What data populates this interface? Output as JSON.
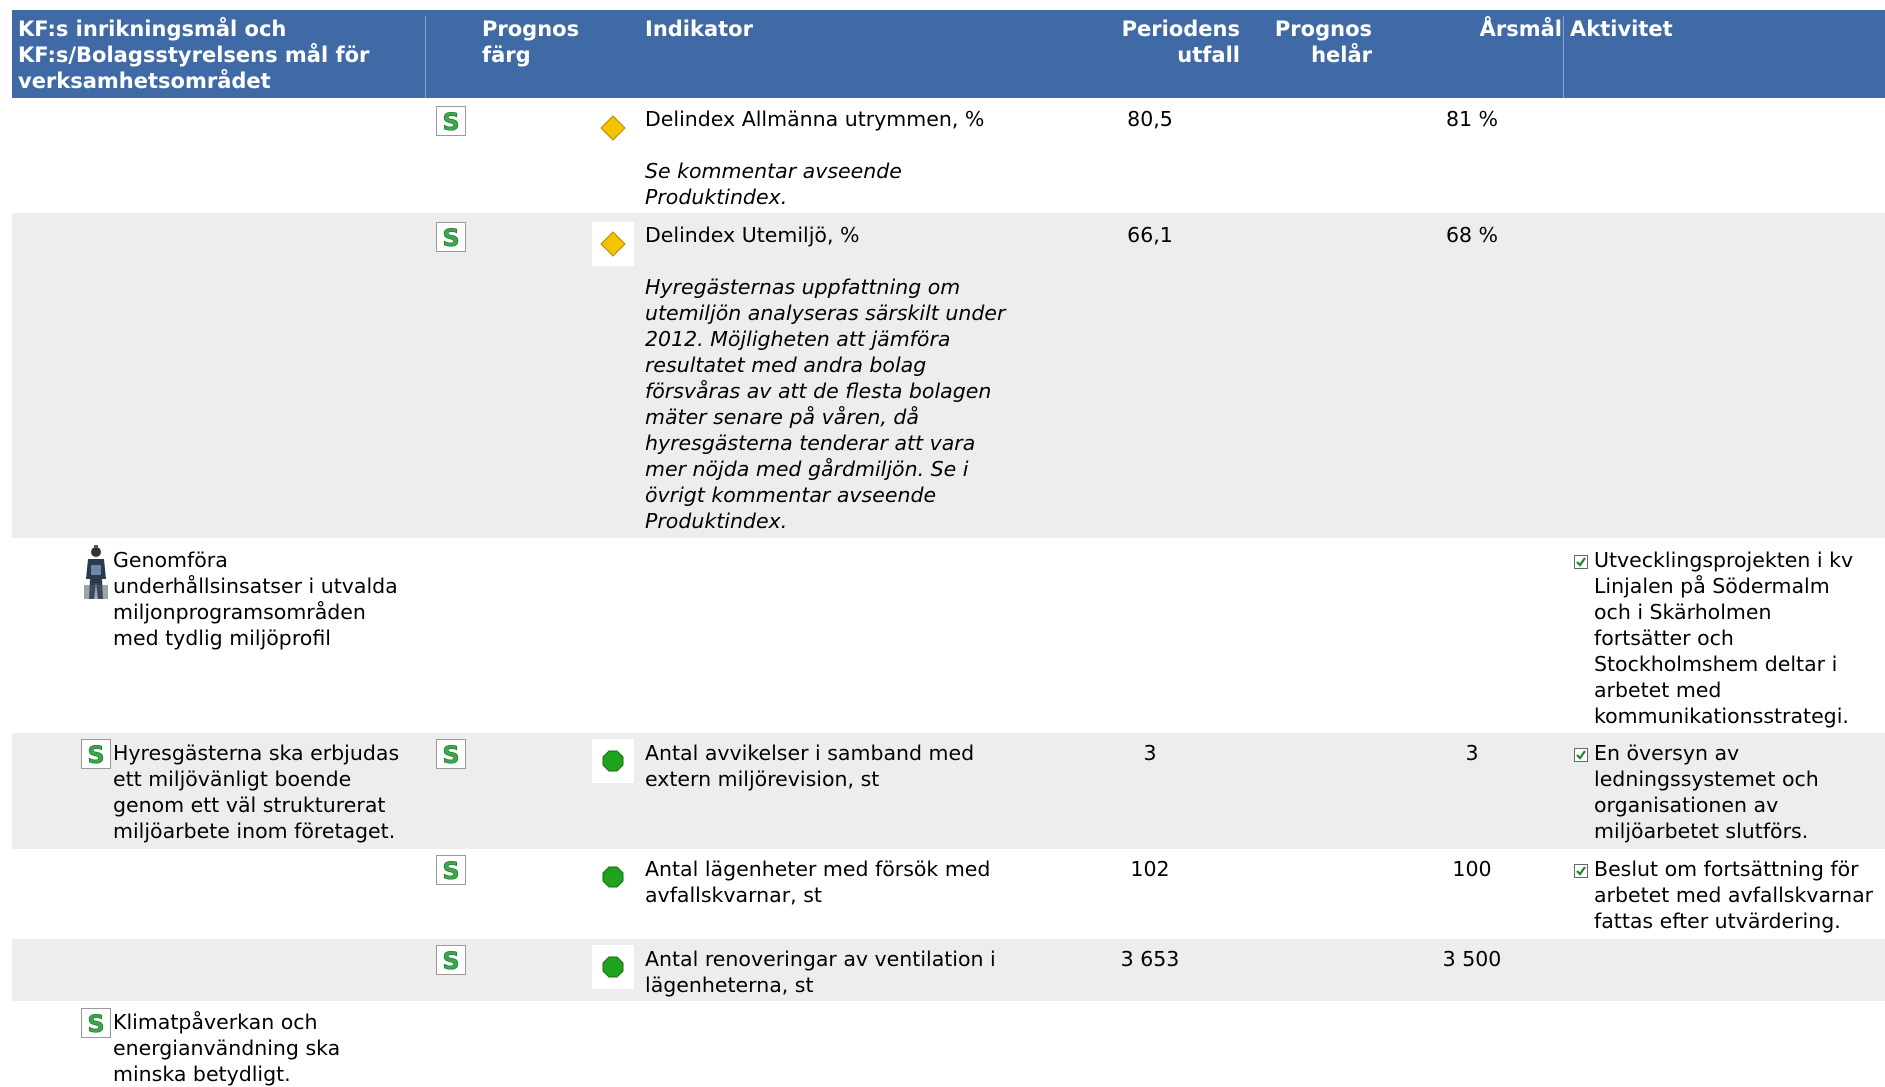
{
  "header": {
    "goal": "KF:s inrikningsmål och KF:s/Bolagsstyrelsens mål för verksamhetsområdet",
    "goal_lines": [
      "KF:s inrikningsmål och",
      "KF:s/Bolagsstyrelsens mål för",
      "verksamhetsområdet"
    ],
    "prognos_farg_lines": [
      "Prognos",
      "färg"
    ],
    "indikator": "Indikator",
    "periodens_utfall_lines": [
      "Periodens",
      "utfall"
    ],
    "prognos_helar_lines": [
      "Prognos",
      "helår"
    ],
    "arsmal": "Årsmål",
    "aktivitet": "Aktivitet"
  },
  "colors": {
    "header_bg": "#3f6aa5",
    "row_alt_bg": "#ededed",
    "status_yellow": "#f5c400",
    "status_green": "#1fa31f"
  },
  "rows": [
    {
      "goal": [],
      "status_icon": "diamond-yellow-icon",
      "indicator": "Delindex Allmänna utrymmen, %",
      "comment": [
        "Se kommentar avseende",
        "Produktindex."
      ],
      "utfall": "80,5",
      "prognos": "",
      "arsmal": "81 %",
      "aktivitet": []
    },
    {
      "goal": [],
      "status_icon": "diamond-yellow-icon",
      "indicator": "Delindex Utemiljö, %",
      "comment": [
        "Hyregästernas uppfattning om",
        "utemiljön analyseras särskilt under",
        "2012. Möjligheten att jämföra",
        "resultatet med andra bolag",
        "försvåras av att de flesta bolagen",
        "mäter senare på våren, då",
        "hyresgästerna tenderar att vara",
        "mer nöjda med gårdmiljön. Se i",
        "övrigt kommentar avseende",
        "Produktindex."
      ],
      "utfall": "66,1",
      "prognos": "",
      "arsmal": "68 %",
      "aktivitet": []
    },
    {
      "goal": [
        "Genomföra",
        "underhållsinsatser i utvalda",
        "miljonprogramsområden",
        "med tydlig miljöprofil"
      ],
      "goal_icon": "person-icon",
      "indicator": "",
      "utfall": "",
      "arsmal": "",
      "aktivitet": [
        "Utvecklingsprojekten i kv",
        "Linjalen på Södermalm",
        "och i Skärholmen",
        "fortsätter och",
        "Stockholmshem deltar i",
        "arbetet med",
        "kommunikationsstrategi."
      ]
    },
    {
      "goal": [
        "Hyresgästerna ska erbjudas",
        "ett miljövänligt boende",
        "genom ett väl strukturerat",
        "miljöarbete inom företaget."
      ],
      "goal_icon": "s-icon",
      "status_icon": "dot-green-icon",
      "indicator": "Antal avvikelser i samband med extern miljörevision, st",
      "indicator_lines": [
        "Antal avvikelser i samband med",
        "extern miljörevision, st"
      ],
      "utfall": "3",
      "arsmal": "3",
      "aktivitet": [
        "En översyn av",
        "ledningssystemet och",
        "organisationen av",
        "miljöarbetet slutförs."
      ]
    },
    {
      "goal": [],
      "status_icon": "dot-green-icon",
      "indicator_lines": [
        "Antal lägenheter med försök med",
        "avfallskvarnar, st"
      ],
      "utfall": "102",
      "arsmal": "100",
      "aktivitet": [
        "Beslut om fortsättning för",
        "arbetet med avfallskvarnar",
        "fattas efter utvärdering."
      ]
    },
    {
      "goal": [],
      "status_icon": "dot-green-icon",
      "indicator_lines": [
        "Antal renoveringar av ventilation i",
        "lägenheterna, st"
      ],
      "utfall": "3 653",
      "arsmal": "3 500",
      "aktivitet": []
    },
    {
      "goal": [
        "Klimatpåverkan och",
        "energianvändning ska",
        "minska betydligt."
      ],
      "goal_icon": "s-icon"
    }
  ]
}
